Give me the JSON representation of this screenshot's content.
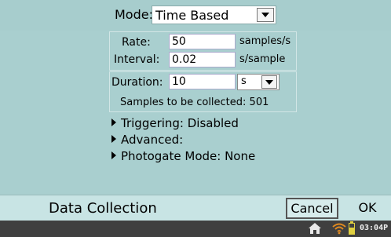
{
  "mode": {
    "label": "Mode:",
    "value": "Time Based"
  },
  "rate": {
    "label": "Rate:",
    "value": "50",
    "unit": "samples/s"
  },
  "interval": {
    "label": "Interval:",
    "value": "0.02",
    "unit": "s/sample"
  },
  "duration": {
    "label": "Duration:",
    "value": "10",
    "unit": "s"
  },
  "samples_text": "Samples to be collected: 501",
  "expanders": {
    "triggering": "Triggering: Disabled",
    "advanced": "Advanced:",
    "photogate": "Photogate Mode: None"
  },
  "footer": {
    "title": "Data Collection",
    "cancel": "Cancel",
    "ok": "OK"
  },
  "status": {
    "clock": "03:04P"
  },
  "colors": {
    "background": "#a9cfcf",
    "footer": "#c8e4e4",
    "statusbar": "#3f3f3f"
  },
  "icons": [
    "home-icon",
    "wifi-icon",
    "battery-icon"
  ]
}
